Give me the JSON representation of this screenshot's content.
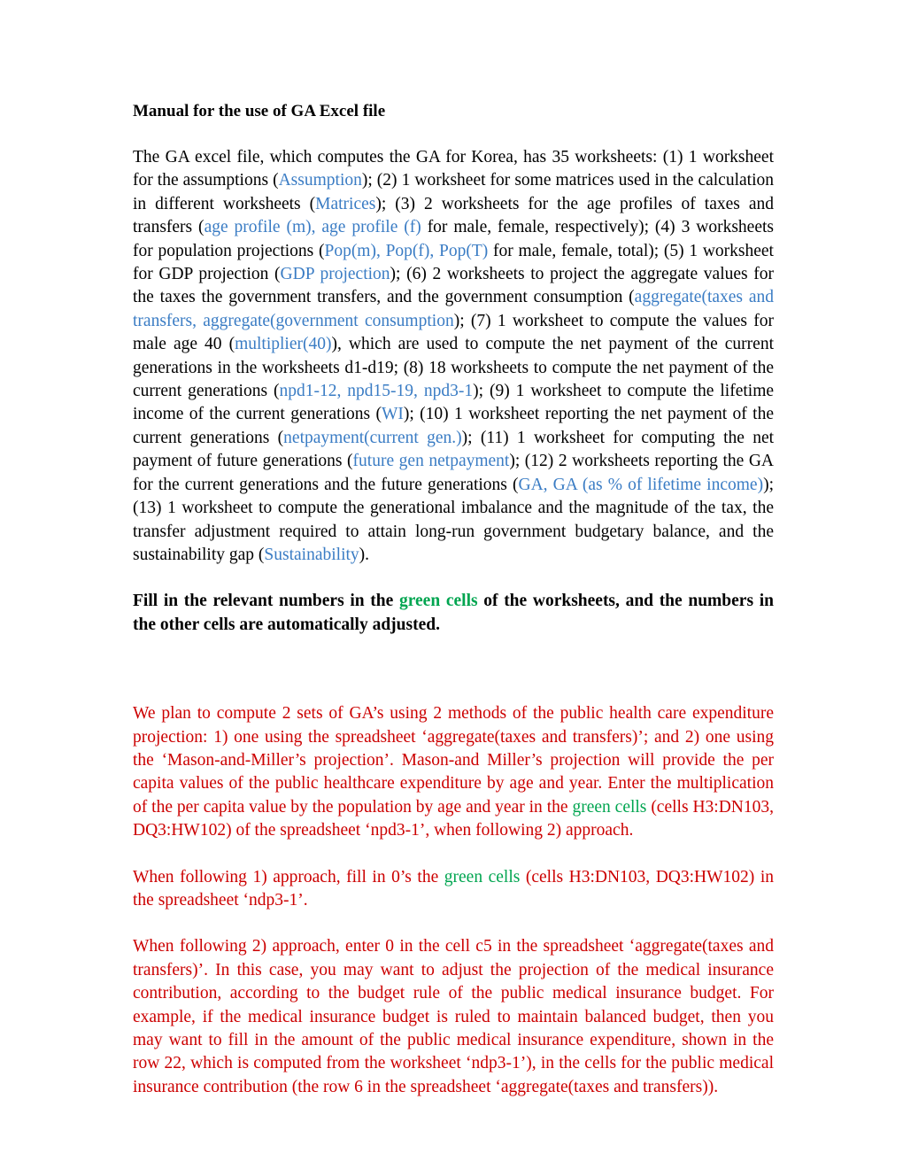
{
  "document": {
    "title": "Manual for the use of GA Excel file",
    "colors": {
      "blue_worksheet": "#3a7cc4",
      "green_cells": "#00a550",
      "red_note": "#cc0000",
      "body_text": "#000000",
      "page_background": "#ffffff"
    },
    "intro_paragraph": {
      "s1": "The GA excel file, which computes the GA for Korea, has 35 worksheets: (1) 1 worksheet for the assumptions (",
      "ws1": "Assumption",
      "s2": "); (2) 1 worksheet for some matrices used in the calculation in different worksheets (",
      "ws2": "Matrices",
      "s3": "); (3) 2 worksheets for the age profiles of taxes and transfers (",
      "ws3": "age profile (m), age profile (f)",
      "s4": " for male, female, respectively); (4) 3 worksheets for population projections (",
      "ws4": "Pop(m), Pop(f), Pop(T)",
      "s5": " for male, female, total); (5) 1 worksheet for GDP projection (",
      "ws5": "GDP projection",
      "s6": "); (6) 2 worksheets to project the aggregate values for the taxes the government transfers, and the government consumption (",
      "ws6": "aggregate(taxes and transfers, aggregate(government consumption",
      "s7": "); (7) 1 worksheet to compute the values for male age 40 (",
      "ws7": "multiplier(40)",
      "s8": "), which are used to compute the net payment of the current generations in the worksheets d1-d19; (8) 18 worksheets to compute the net payment of the current generations (",
      "ws8": "npd1-12, npd15-19, npd3-1",
      "s9": "); (9) 1 worksheet to compute the lifetime income of the current generations (",
      "ws9": "WI",
      "s10": ");  (10) 1 worksheet reporting the net payment of the current generations (",
      "ws10": "netpayment(current gen.)",
      "s11": "); (11) 1 worksheet for computing the net payment of future generations (",
      "ws11": "future gen netpayment",
      "s12": "); (12) 2 worksheets reporting the GA for the current generations and the future generations (",
      "ws12": "GA, GA (as % of lifetime income)",
      "s13": "); (13) 1 worksheet to compute the generational imbalance and the magnitude of the tax, the transfer adjustment required to attain long-run government budgetary balance,  and the sustainability gap (",
      "ws13": "Sustainability",
      "s14": ")."
    },
    "fill_in_paragraph": {
      "s1": "Fill in the relevant numbers in the ",
      "green1": "green cells",
      "s2": " of the worksheets, and the numbers in the other cells are automatically adjusted."
    },
    "note_paragraph_1": {
      "s1": "We plan to compute 2 sets of GA’s using 2 methods of the public health care expenditure projection: 1) one using the spreadsheet ‘aggregate(taxes and transfers)’; and 2) one using the ‘Mason-and-Miller’s projection’.  Mason-and Miller’s projection will provide the per capita values of the public healthcare expenditure by age and year. Enter the multiplication of the per capita value by the population by age and year in the ",
      "green1": "green cells",
      "s2": " (cells H3:DN103, DQ3:HW102) of the spreadsheet ‘npd3-1’, when following 2) approach."
    },
    "note_paragraph_2": {
      "s1": "When following 1) approach, fill in 0’s the ",
      "green1": "green cells",
      "s2": " (cells H3:DN103, DQ3:HW102) in the spreadsheet ‘ndp3-1’."
    },
    "note_paragraph_3": {
      "s1": "When following 2) approach, enter 0 in the cell c5 in the spreadsheet ‘aggregate(taxes and transfers)’. In this case, you may want to adjust the projection of the medical insurance contribution, according to the budget rule of the public medical insurance budget. For example, if the medical insurance budget is ruled to maintain balanced budget, then you may want to fill in the amount of the public medical insurance expenditure, shown in the row 22, which is computed from the worksheet ‘ndp3-1’), in the cells for the public medical insurance contribution (the row 6 in the spreadsheet ‘aggregate(taxes and transfers))."
    }
  }
}
